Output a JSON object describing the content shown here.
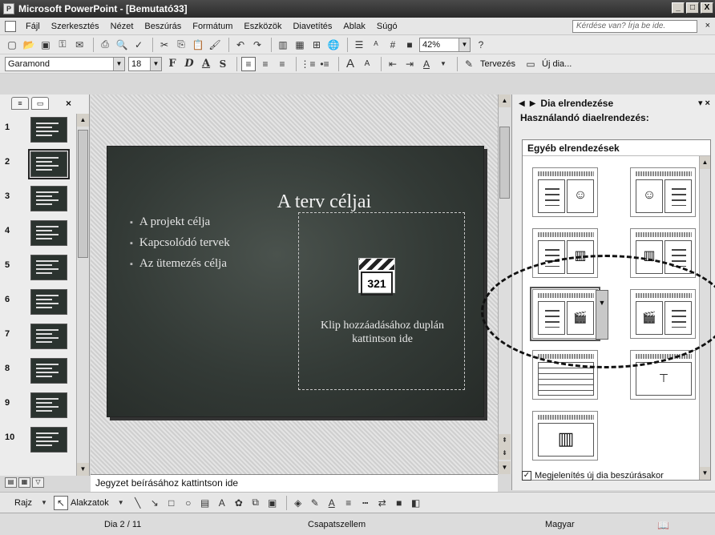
{
  "window": {
    "title": "Microsoft PowerPoint - [Bemutató33]",
    "minimize": "_",
    "restore": "□",
    "close": "X"
  },
  "menu": {
    "items": [
      {
        "label": "Fájl"
      },
      {
        "label": "Szerkesztés"
      },
      {
        "label": "Nézet"
      },
      {
        "label": "Beszúrás"
      },
      {
        "label": "Formátum"
      },
      {
        "label": "Eszközök"
      },
      {
        "label": "Diavetítés"
      },
      {
        "label": "Ablak"
      },
      {
        "label": "Súgó"
      }
    ],
    "help_placeholder": "Kérdése van? Írja be ide.",
    "close": "×"
  },
  "standard_toolbar": {
    "zoom": "42%"
  },
  "format_toolbar": {
    "font": "Garamond",
    "size": "18",
    "bold": "F",
    "italic": "D",
    "underline": "A",
    "shadow": "S",
    "design_label": "Tervezés",
    "new_slide_label": "Új dia..."
  },
  "left_pane": {
    "close": "×",
    "slides": [
      "1",
      "2",
      "3",
      "4",
      "5",
      "6",
      "7",
      "8",
      "9",
      "10"
    ],
    "selected": 2
  },
  "slide": {
    "title": "A terv céljai",
    "bullets": [
      "A projekt célja",
      "Kapcsolódó tervek",
      "Az ütemezés célja"
    ],
    "clip_number": "321",
    "clip_text": "Klip hozzáadásához duplán kattintson ide"
  },
  "notes": {
    "placeholder": "Jegyzet beírásához kattintson ide"
  },
  "task_pane": {
    "title": "Dia elrendezése",
    "subtitle": "Használandó diaelrendezés:",
    "section": "Egyéb elrendezések",
    "show_on_insert": "Megjelenítés új dia beszúrásakor",
    "show_on_insert_checked": true
  },
  "drawing_toolbar": {
    "draw_label": "Rajz",
    "shapes_label": "Alakzatok"
  },
  "status": {
    "slide_counter": "Dia 2 / 11",
    "design": "Csapatszellem",
    "language": "Magyar"
  }
}
